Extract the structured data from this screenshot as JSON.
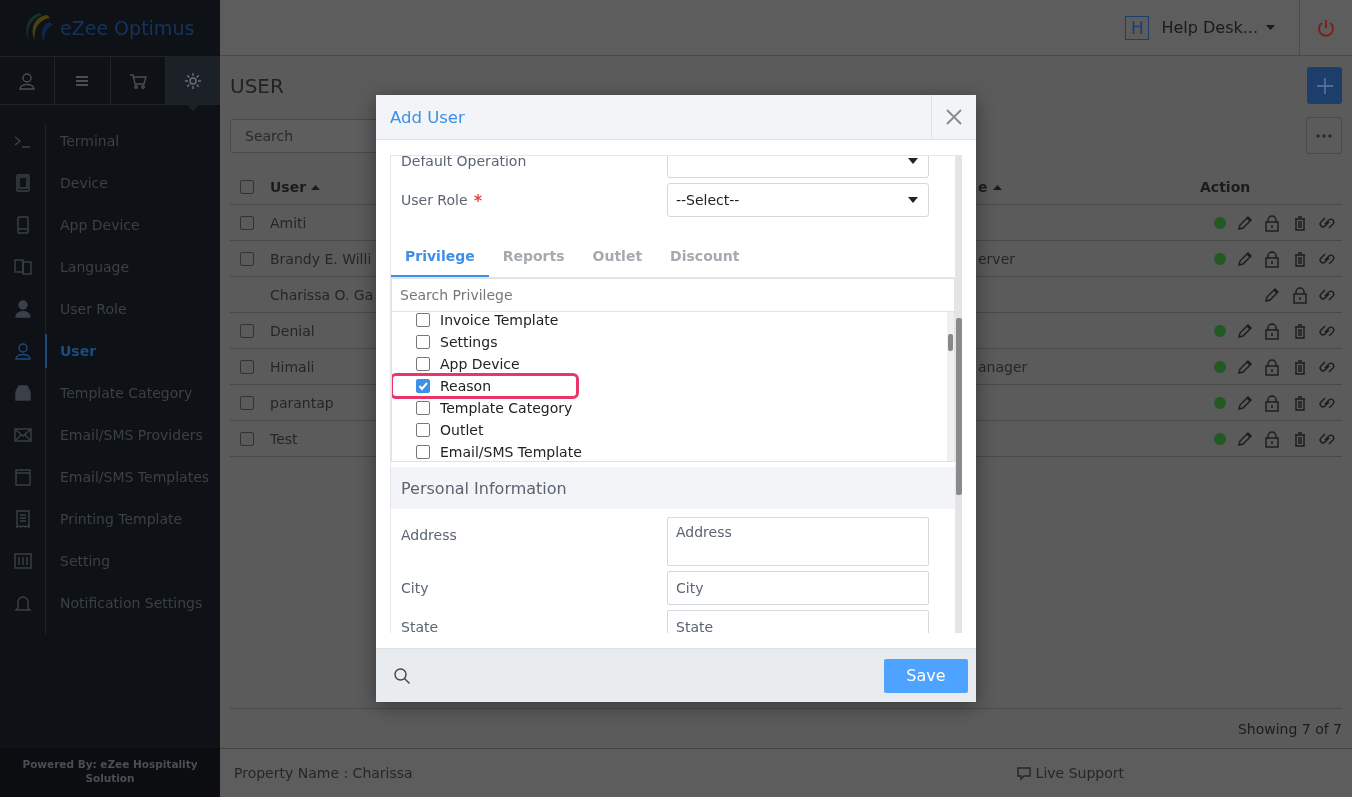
{
  "sidebar": {
    "logo": "eZee Optimus",
    "tabs": [
      {
        "selected": false
      },
      {
        "selected": false
      },
      {
        "selected": false
      },
      {
        "selected": true
      }
    ],
    "items": [
      {
        "label": "Terminal",
        "selected": false
      },
      {
        "label": "Device",
        "selected": false
      },
      {
        "label": "App Device",
        "selected": false
      },
      {
        "label": "Language",
        "selected": false
      },
      {
        "label": "User Role",
        "selected": false
      },
      {
        "label": "User",
        "selected": true
      },
      {
        "label": "Template Category",
        "selected": false
      },
      {
        "label": "Email/SMS Providers",
        "selected": false
      },
      {
        "label": "Email/SMS Templates",
        "selected": false
      },
      {
        "label": "Printing Template",
        "selected": false
      },
      {
        "label": "Setting",
        "selected": false
      },
      {
        "label": "Notification Settings",
        "selected": false
      }
    ],
    "footer": "Powered By: eZee Hospitality Solution"
  },
  "header": {
    "badge": "H",
    "user": "Help Desk..."
  },
  "page": {
    "title": "USER",
    "search": {
      "placeholder": "Search"
    }
  },
  "table": {
    "all_checked": false,
    "columns": [
      "User",
      "e",
      "Action"
    ],
    "rows": [
      {
        "user": "Amiti",
        "checked": false,
        "active": true,
        "deletable": true
      },
      {
        "user": "Brandy E. Willi",
        "checked": false,
        "role_part": "erver",
        "active": true,
        "deletable": true
      },
      {
        "user": "Charissa O. Ga",
        "active": false,
        "deletable": false
      },
      {
        "user": "Denial",
        "checked": false,
        "active": true,
        "deletable": true
      },
      {
        "user": "Himali",
        "checked": false,
        "role_part": "anager",
        "active": true,
        "deletable": true
      },
      {
        "user": "parantap",
        "checked": false,
        "active": true,
        "deletable": true
      },
      {
        "user": "Test",
        "checked": false,
        "active": true,
        "deletable": true
      }
    ]
  },
  "pager": "Showing 7 of 7",
  "footer": {
    "property": "Property Name : Charissa",
    "support": "Live Support"
  },
  "modal": {
    "title": "Add User",
    "top_fields": [
      {
        "label": "Default Operation",
        "required": false
      },
      {
        "label": "User Role",
        "required": true,
        "value": "--Select--"
      }
    ],
    "tabs": [
      {
        "label": "Privilege",
        "selected": true
      },
      {
        "label": "Reports",
        "selected": false
      },
      {
        "label": "Outlet",
        "selected": false
      },
      {
        "label": "Discount",
        "selected": false
      }
    ],
    "search": {
      "placeholder": "Search Privilege"
    },
    "privileges": [
      {
        "label": "Invoice Template",
        "checked": false,
        "highlighted": false
      },
      {
        "label": "Settings",
        "checked": false,
        "highlighted": false
      },
      {
        "label": "App Device",
        "checked": false,
        "highlighted": false
      },
      {
        "label": "Reason",
        "checked": true,
        "highlighted": true
      },
      {
        "label": "Template Category",
        "checked": false,
        "highlighted": false
      },
      {
        "label": "Outlet",
        "checked": false,
        "highlighted": false
      },
      {
        "label": "Email/SMS Template",
        "checked": false,
        "highlighted": false
      }
    ],
    "section": "Personal Information",
    "fields": [
      {
        "label": "Address",
        "placeholder": "Address",
        "kind": "textarea"
      },
      {
        "label": "City",
        "placeholder": "City",
        "kind": "input"
      },
      {
        "label": "State",
        "placeholder": "State",
        "kind": "input"
      }
    ],
    "save": "Save"
  }
}
